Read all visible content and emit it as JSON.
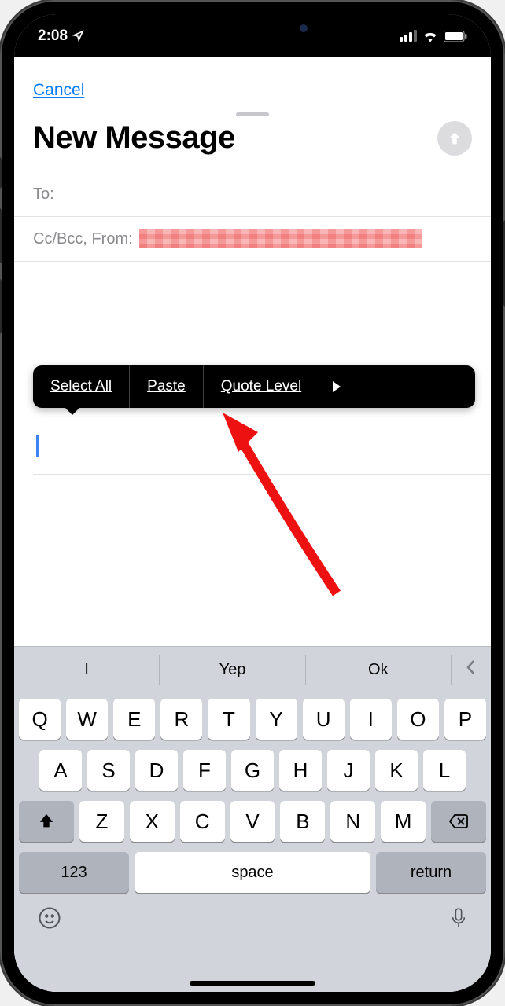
{
  "statusbar": {
    "time": "2:08"
  },
  "compose": {
    "cancel": "Cancel",
    "title": "New Message",
    "to_label": "To:",
    "ccbcc_label": "Cc/Bcc, From:"
  },
  "edit_menu": {
    "select_all": "Select All",
    "paste": "Paste",
    "quote_level": "Quote Level"
  },
  "suggestions": {
    "s1": "I",
    "s2": "Yep",
    "s3": "Ok"
  },
  "keys": {
    "r1": [
      "Q",
      "W",
      "E",
      "R",
      "T",
      "Y",
      "U",
      "I",
      "O",
      "P"
    ],
    "r2": [
      "A",
      "S",
      "D",
      "F",
      "G",
      "H",
      "J",
      "K",
      "L"
    ],
    "r3": [
      "Z",
      "X",
      "C",
      "V",
      "B",
      "N",
      "M"
    ],
    "numbers": "123",
    "space": "space",
    "return": "return"
  }
}
